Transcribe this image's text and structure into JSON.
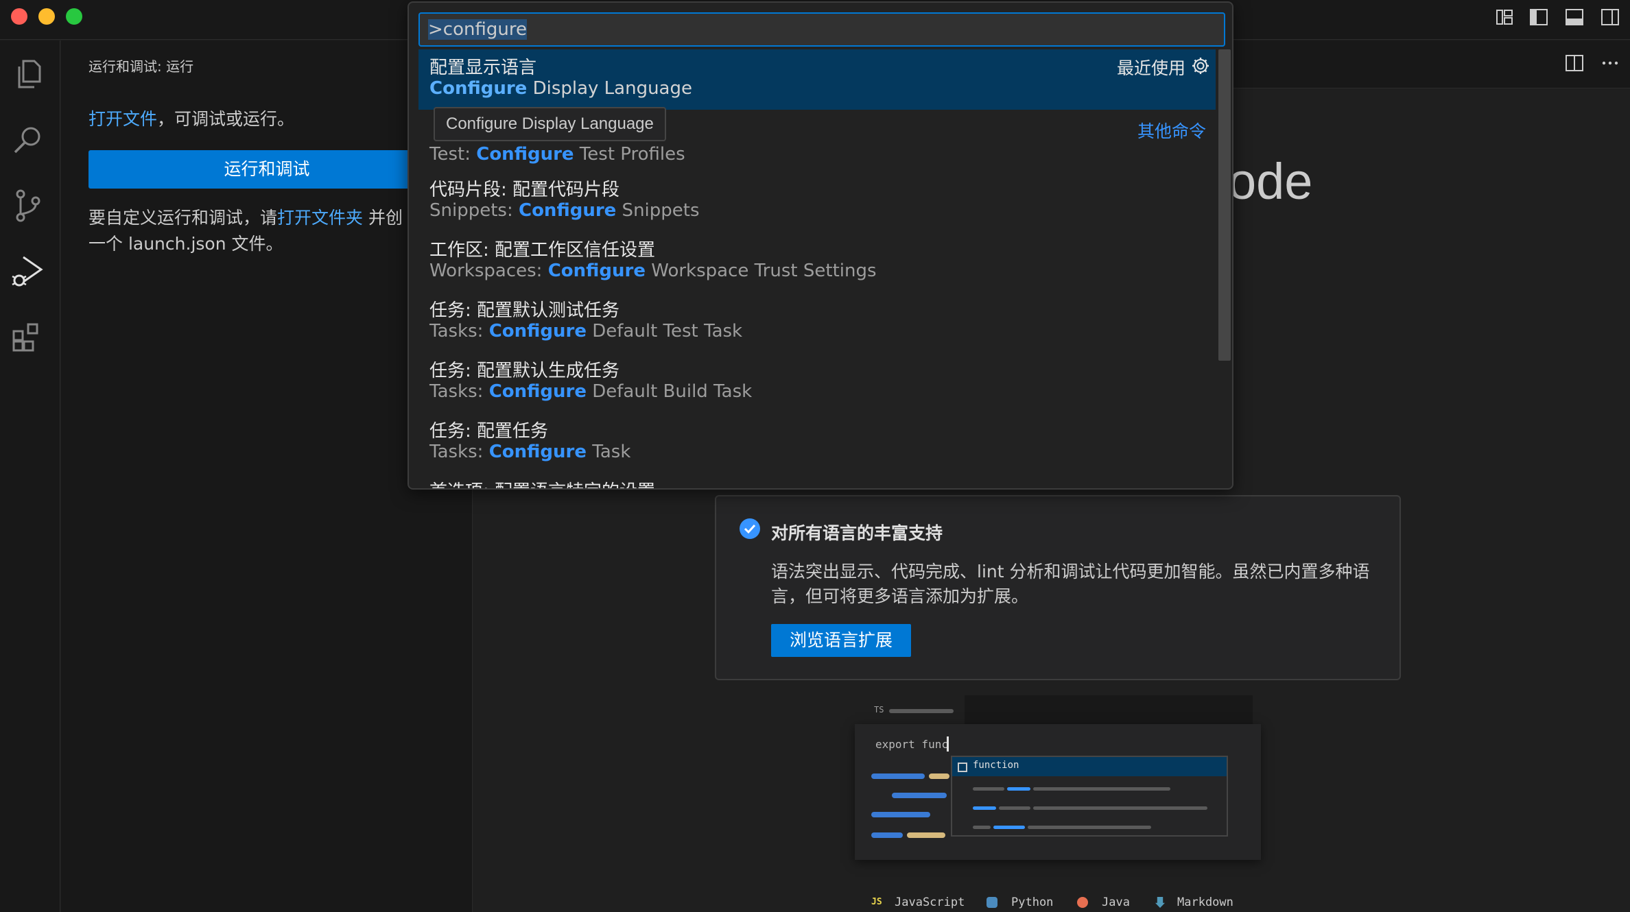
{
  "titlebar": {
    "traffic_colors": [
      "#ff5f57",
      "#febc2e",
      "#28c840"
    ],
    "right_icons": [
      "customize-layout-icon",
      "toggle-primary-sidebar-icon",
      "toggle-panel-icon",
      "toggle-secondary-sidebar-icon"
    ]
  },
  "activity_bar": {
    "items": [
      "explorer-icon",
      "search-icon",
      "source-control-icon",
      "run-debug-icon",
      "extensions-icon"
    ],
    "active": "run-debug-icon"
  },
  "sidebar": {
    "title": "运行和调试: 运行",
    "open_file_link": "打开文件",
    "open_file_rest": "，可调试或运行。",
    "run_button": "运行和调试",
    "customize_prefix": "要自定义运行和调试，请",
    "open_folder_link": "打开文件夹",
    "customize_suffix": " 并创",
    "customize_line2": "一个 launch.json 文件。"
  },
  "editor": {
    "heading_fragment": "ode",
    "actions": [
      "split-editor-icon",
      "more-actions-icon"
    ]
  },
  "walkthrough": {
    "title": "对所有语言的丰富支持",
    "description": "语法突出显示、代码完成、lint 分析和调试让代码更加智能。虽然已内置多种语言，但可将更多语言添加为扩展。",
    "button": "浏览语言扩展"
  },
  "preview": {
    "tab_label": "TS",
    "code": "export func",
    "suggestion": "function"
  },
  "languages": [
    "JavaScript",
    "Python",
    "Java",
    "Markdown"
  ],
  "language_badges": [
    "JS"
  ],
  "command_palette": {
    "input_value": ">configure",
    "recent_label": "最近使用",
    "other_commands": "其他命令",
    "tooltip": "Configure Display Language",
    "items": [
      {
        "label": "配置显示语言",
        "detail_hl": "Configure",
        "detail_rest": " Display Language",
        "detail_prefix": ""
      },
      {
        "label": "",
        "detail_prefix": "Test: ",
        "detail_hl": "Configure",
        "detail_rest": " Test Profiles"
      },
      {
        "label": "代码片段: 配置代码片段",
        "detail_prefix": "Snippets: ",
        "detail_hl": "Configure",
        "detail_rest": " Snippets"
      },
      {
        "label": "工作区: 配置工作区信任设置",
        "detail_prefix": "Workspaces: ",
        "detail_hl": "Configure",
        "detail_rest": " Workspace Trust Settings"
      },
      {
        "label": "任务: 配置默认测试任务",
        "detail_prefix": "Tasks: ",
        "detail_hl": "Configure",
        "detail_rest": " Default Test Task"
      },
      {
        "label": "任务: 配置默认生成任务",
        "detail_prefix": "Tasks: ",
        "detail_hl": "Configure",
        "detail_rest": " Default Build Task"
      },
      {
        "label": "任务: 配置任务",
        "detail_prefix": "Tasks: ",
        "detail_hl": "Configure",
        "detail_rest": " Task"
      },
      {
        "label": "首选项: 配置语言特定的设置",
        "detail_prefix": "",
        "detail_hl": "",
        "detail_rest": ""
      }
    ]
  },
  "colors": {
    "accent": "#0078d4",
    "link": "#3794ff",
    "background": "#1f1f1f"
  }
}
